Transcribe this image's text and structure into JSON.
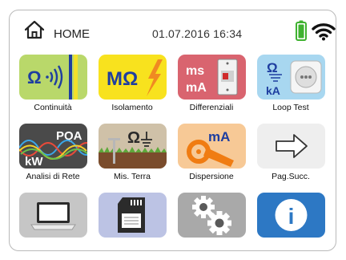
{
  "header": {
    "home_label": "HOME",
    "datetime": "01.07.2016  16:34",
    "icons": [
      "home-icon",
      "battery-icon",
      "wifi-icon"
    ]
  },
  "colors": {
    "continuita_bg": "#b9d86a",
    "isolamento_bg": "#f8e21e",
    "differenziali_bg": "#d9646f",
    "loop_bg": "#a8d7f0",
    "analisi_bg": "#4a4a4a",
    "terra_bg": "#cfc1a8",
    "dispersione_bg": "#f7c996",
    "pag_bg": "#eeeeee",
    "pc_bg": "#c6c6c6",
    "sd_bg": "#bcc3e4",
    "settings_bg": "#a9a9a9",
    "info_bg": "#2d78c4",
    "battery_green": "#3fb230"
  },
  "tiles": [
    {
      "label": "Continuità",
      "icon": "continuity-icon",
      "text": "Ω·))"
    },
    {
      "label": "Isolamento",
      "icon": "insulation-icon",
      "text": "MΩ"
    },
    {
      "label": "Differenziali",
      "icon": "rcd-icon",
      "text_top": "ms",
      "text_bottom": "mA"
    },
    {
      "label": "Loop Test",
      "icon": "loop-test-icon",
      "text_top": "Ω",
      "text_bottom": "kA"
    },
    {
      "label": "Analisi di Rete",
      "icon": "network-analysis-icon",
      "text_top": "PQA",
      "text_bottom": "kW"
    },
    {
      "label": "Mis. Terra",
      "icon": "earth-icon",
      "text": "Ω"
    },
    {
      "label": "Dispersione",
      "icon": "leakage-clamp-icon",
      "text": "mA"
    },
    {
      "label": "Pag.Succ.",
      "icon": "arrow-right-icon"
    },
    {
      "label": "",
      "icon": "laptop-icon"
    },
    {
      "label": "",
      "icon": "sd-card-icon"
    },
    {
      "label": "",
      "icon": "gears-icon"
    },
    {
      "label": "",
      "icon": "info-icon",
      "text": "i"
    }
  ]
}
